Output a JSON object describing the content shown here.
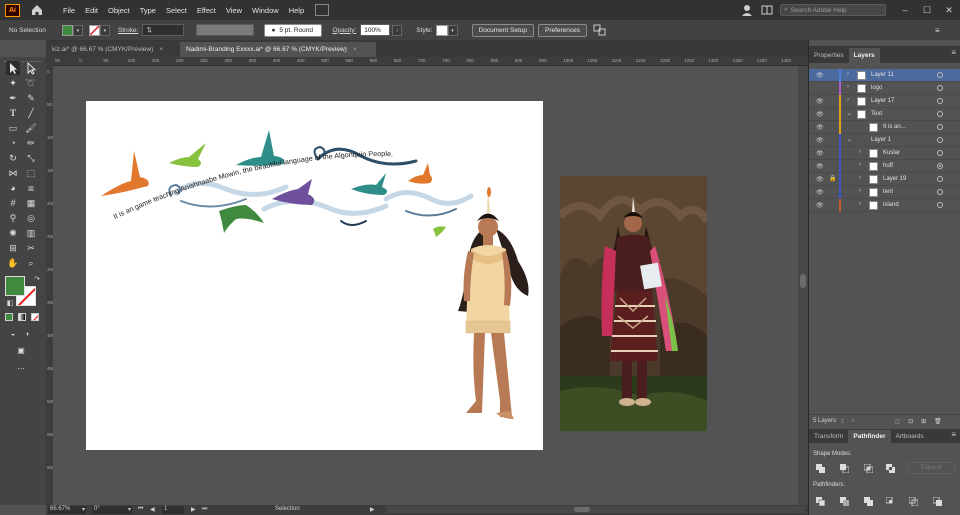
{
  "app": {
    "logo": "Ai",
    "menus": [
      "File",
      "Edit",
      "Object",
      "Type",
      "Select",
      "Effect",
      "View",
      "Window",
      "Help"
    ],
    "search_placeholder": "Search Adobe Help"
  },
  "control_bar": {
    "selection_label": "No Selection",
    "stroke_label": "Stroke:",
    "brush_label": "5 pt. Round",
    "opacity_label": "Opacity:",
    "opacity_value": "100%",
    "style_label": "Style:",
    "document_setup": "Document Setup",
    "preferences": "Preferences"
  },
  "tabs": [
    {
      "label": "kiz.ai* @ 66.67 % (CMYK/Preview)",
      "close": "×",
      "active": false
    },
    {
      "label": "Nadimi-Branding Exxxx.ai* @ 66.67 % (CMYK/Preview)",
      "close": "×",
      "active": true
    }
  ],
  "rulers": {
    "horizontal": [
      "50",
      "0",
      "50",
      "100",
      "150",
      "200",
      "250",
      "300",
      "350",
      "400",
      "450",
      "500",
      "550",
      "600",
      "650",
      "700",
      "750",
      "800",
      "850",
      "900",
      "950",
      "1000",
      "1050",
      "1100",
      "1150",
      "1200",
      "1250",
      "1300",
      "1350",
      "1400",
      "1450"
    ],
    "vertical": [
      "0",
      "50",
      "100",
      "150",
      "200",
      "250",
      "300",
      "350",
      "400",
      "450",
      "500",
      "550",
      "600"
    ]
  },
  "artboard": {
    "curved_text": "It is an game teaching Anishnaabe Mowin, the beautiful language of the Algonquin People."
  },
  "status": {
    "zoom": "66.67%",
    "rotation": "0°",
    "artboard_num": "1",
    "tool": "Selection"
  },
  "panels": {
    "top_tabs": [
      "Properties",
      "Layers"
    ],
    "layers": [
      {
        "name": "Layer 11",
        "depth": 0,
        "expand": ">",
        "eye": true,
        "lock": false,
        "color": "#4f7fd6",
        "selected": true,
        "thumb": true
      },
      {
        "name": "logo",
        "depth": 0,
        "expand": ">",
        "eye": false,
        "lock": false,
        "color": "#b05cc9",
        "selected": false,
        "thumb": true
      },
      {
        "name": "Layer 17",
        "depth": 0,
        "expand": ">",
        "eye": true,
        "lock": false,
        "color": "#e0a020",
        "selected": false,
        "thumb": true
      },
      {
        "name": "Text",
        "depth": 0,
        "expand": "v",
        "eye": true,
        "lock": false,
        "color": "#e0a020",
        "selected": false,
        "thumb": true
      },
      {
        "name": "It is an...",
        "depth": 1,
        "expand": "",
        "eye": true,
        "lock": false,
        "color": "#e0a020",
        "selected": false,
        "thumb": true
      },
      {
        "name": "Layer 1",
        "depth": 0,
        "expand": "v",
        "eye": true,
        "lock": false,
        "color": "#3d55c7",
        "selected": false,
        "thumb": false
      },
      {
        "name": "Kuslar",
        "depth": 1,
        "expand": ">",
        "eye": true,
        "lock": false,
        "color": "#3d55c7",
        "selected": false,
        "thumb": true
      },
      {
        "name": "huff",
        "depth": 1,
        "expand": ">",
        "eye": true,
        "lock": false,
        "color": "#3d55c7",
        "selected": false,
        "thumb": true
      },
      {
        "name": "Layer 19",
        "depth": 1,
        "expand": ">",
        "eye": true,
        "lock": true,
        "color": "#3d55c7",
        "selected": false,
        "thumb": true
      },
      {
        "name": "tent",
        "depth": 1,
        "expand": ">",
        "eye": true,
        "lock": false,
        "color": "#3d55c7",
        "selected": false,
        "thumb": true
      },
      {
        "name": "island",
        "depth": 1,
        "expand": ">",
        "eye": true,
        "lock": false,
        "color": "#c25a2a",
        "selected": false,
        "thumb": true
      }
    ],
    "layer_count": "5 Layers",
    "bottom_tabs": [
      "Transform",
      "Pathfinder",
      "Artboards"
    ],
    "shape_modes_label": "Shape Modes:",
    "expand_label": "Expand",
    "pathfinders_label": "Pathfinders:"
  },
  "colors": {
    "accent_selected": "#4b6a9e",
    "fill_color": "#3f8a3f",
    "app_logo": "#ff9a00"
  }
}
